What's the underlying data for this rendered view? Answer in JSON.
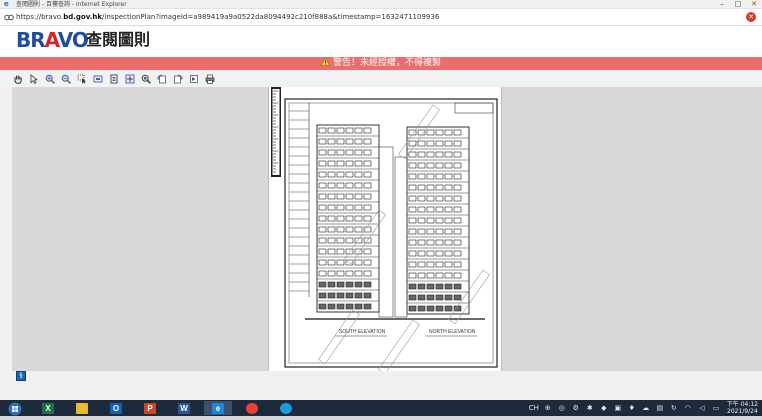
{
  "window": {
    "title": "查閱圖則 - 百樓查詢 - Internet Explorer",
    "controls": {
      "minimize": "–",
      "maximize": "□",
      "close": "✕"
    }
  },
  "address_bar": {
    "url_prefix": "https://bravo.",
    "url_domain": "bd.gov.hk",
    "url_rest": "/inspectionPlan?imageId=a989419a9a0522da8094492c210f888a&timestamp=1632471109936",
    "close_tab": "✕"
  },
  "header": {
    "logo_blue_1": "BR",
    "logo_red": "A",
    "logo_blue_2": "VO",
    "title": "查閱圖則"
  },
  "warning": {
    "text": "警告！未經授權，不得複製",
    "color": "#ec6d6d"
  },
  "toolbar": {
    "tools": [
      "pan-hand",
      "pointer",
      "zoom-in",
      "zoom-out",
      "select",
      "fit-page",
      "fit-width",
      "actual-size",
      "magnify",
      "rotate-left",
      "rotate-right",
      "flip",
      "print"
    ]
  },
  "document": {
    "stamp_text": "COPY",
    "caption_left": "SOUTH ELEVATION",
    "caption_right": "NORTH ELEVATION"
  },
  "taskbar": {
    "apps": [
      {
        "name": "excel",
        "label": "X",
        "color": "#1d7044"
      },
      {
        "name": "file-explorer",
        "label": "",
        "color": "#e8b931"
      },
      {
        "name": "outlook",
        "label": "O",
        "color": "#0f63b4"
      },
      {
        "name": "powerpoint",
        "label": "P",
        "color": "#c6462a"
      },
      {
        "name": "word",
        "label": "W",
        "color": "#2b5696"
      },
      {
        "name": "internet-explorer",
        "label": "e",
        "color": "#1d88d8"
      },
      {
        "name": "chrome",
        "label": "",
        "color": "#e94235"
      },
      {
        "name": "edge",
        "label": "",
        "color": "#1b9bd7"
      }
    ],
    "lang": "CH",
    "clock_time": "下午 04:12",
    "clock_date": "2021/9/24"
  },
  "corner_badge": "§"
}
